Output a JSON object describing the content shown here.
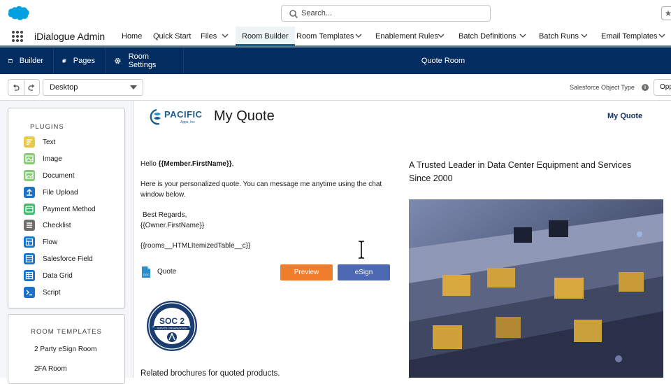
{
  "header": {
    "search_placeholder": "Search...",
    "favorites_icon": "star-icon"
  },
  "nav": {
    "app_name": "iDialogue Admin",
    "items": [
      {
        "label": "Home"
      },
      {
        "label": "Quick Start"
      },
      {
        "label": "Files"
      },
      {
        "label": "Room Builder"
      },
      {
        "label": "Room Templates"
      },
      {
        "label": "Enablement Rules"
      },
      {
        "label": "Batch Definitions"
      },
      {
        "label": "Batch Runs"
      },
      {
        "label": "Email Templates"
      }
    ],
    "active": "Room Builder"
  },
  "builder": {
    "tabs": [
      {
        "label": "Builder",
        "icon": "builder-icon"
      },
      {
        "label": "Pages",
        "icon": "pages-icon"
      },
      {
        "label": "Room Settings",
        "icon": "gear-icon"
      }
    ],
    "room_name": "Quote Room"
  },
  "controls": {
    "device": "Desktop",
    "object_type_label": "Salesforce Object Type",
    "object_type_value": "Opportunity"
  },
  "sidebar": {
    "plugins_title": "PLUGINS",
    "plugins": [
      {
        "label": "Text",
        "icon": "text-icon",
        "color": "#e7c94b"
      },
      {
        "label": "Image",
        "icon": "image-icon",
        "color": "#8bc97b"
      },
      {
        "label": "Document",
        "icon": "document-icon",
        "color": "#8bc97b"
      },
      {
        "label": "File Upload",
        "icon": "file-upload-icon",
        "color": "#1b73c9"
      },
      {
        "label": "Payment Method",
        "icon": "payment-method-icon",
        "color": "#3ebc6f"
      },
      {
        "label": "Checklist",
        "icon": "checklist-icon",
        "color": "#706e6b"
      },
      {
        "label": "Flow",
        "icon": "flow-icon",
        "color": "#1b73c9"
      },
      {
        "label": "Salesforce Field",
        "icon": "salesforce-field-icon",
        "color": "#1b73c9"
      },
      {
        "label": "Data Grid",
        "icon": "data-grid-icon",
        "color": "#1b73c9"
      },
      {
        "label": "Script",
        "icon": "script-icon",
        "color": "#1b73c9"
      }
    ],
    "templates_title": "ROOM TEMPLATES",
    "templates": [
      {
        "label": "2 Party eSign Room"
      },
      {
        "label": "2FA Room"
      }
    ]
  },
  "canvas": {
    "logo_text": "PACIFIC",
    "logo_subtext": "Apps, Inc",
    "heading": "My Quote",
    "nav_link": "My Quote",
    "greeting_prefix": "Hello ",
    "greeting_token": "{{Member.FirstName}}",
    "greeting_suffix": ",",
    "message": "Here is your personalized quote. You can message me anytime using the chat window below.",
    "regards": "Best Regards,",
    "owner_token": "{{Owner.FirstName}}",
    "table_token": "{{rooms__HTMLItemizedTable__c}}",
    "document_label": "Quote",
    "preview_button": "Preview",
    "esign_button": "eSign",
    "badge_title": "SOC 2",
    "badge_subtitle": "SERVICE ORGANIZATION",
    "related": "Related brochures for quoted products.",
    "tagline": "A Trusted Leader in Data Center Equipment and Services Since 2000"
  }
}
